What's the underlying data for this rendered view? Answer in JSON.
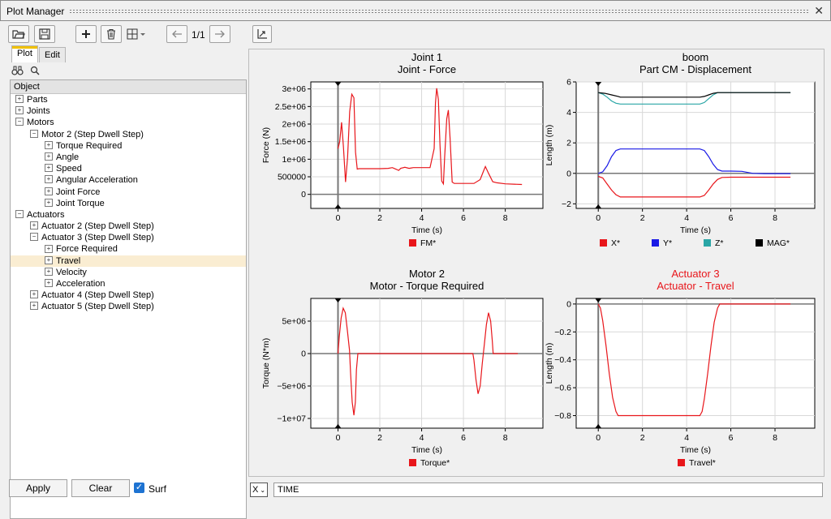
{
  "window": {
    "title": "Plot Manager"
  },
  "toolbar": {
    "page": "1/1"
  },
  "left_panel": {
    "tabs": [
      {
        "label": "Plot"
      },
      {
        "label": "Edit"
      }
    ],
    "tree_header": "Object",
    "tree": [
      {
        "label": "Parts",
        "depth": 0,
        "exp": "+"
      },
      {
        "label": "Joints",
        "depth": 0,
        "exp": "+"
      },
      {
        "label": "Motors",
        "depth": 0,
        "exp": "−"
      },
      {
        "label": "Motor 2 (Step Dwell Step)",
        "depth": 1,
        "exp": "−"
      },
      {
        "label": "Torque Required",
        "depth": 2,
        "exp": "+"
      },
      {
        "label": "Angle",
        "depth": 2,
        "exp": "+"
      },
      {
        "label": "Speed",
        "depth": 2,
        "exp": "+"
      },
      {
        "label": "Angular Acceleration",
        "depth": 2,
        "exp": "+"
      },
      {
        "label": "Joint Force",
        "depth": 2,
        "exp": "+"
      },
      {
        "label": "Joint Torque",
        "depth": 2,
        "exp": "+"
      },
      {
        "label": "Actuators",
        "depth": 0,
        "exp": "−"
      },
      {
        "label": "Actuator 2 (Step Dwell Step)",
        "depth": 1,
        "exp": "+"
      },
      {
        "label": "Actuator 3 (Step Dwell Step)",
        "depth": 1,
        "exp": "−"
      },
      {
        "label": "Force Required",
        "depth": 2,
        "exp": "+"
      },
      {
        "label": "Travel",
        "depth": 2,
        "exp": "+",
        "selected": true
      },
      {
        "label": "Velocity",
        "depth": 2,
        "exp": "+"
      },
      {
        "label": "Acceleration",
        "depth": 2,
        "exp": "+"
      },
      {
        "label": "Actuator 4 (Step Dwell Step)",
        "depth": 1,
        "exp": "+"
      },
      {
        "label": "Actuator 5 (Step Dwell Step)",
        "depth": 1,
        "exp": "+"
      }
    ],
    "apply_label": "Apply",
    "clear_label": "Clear",
    "surf_label": "Surf",
    "surf_checked": true
  },
  "bottom_bar": {
    "axis": "X",
    "expression": "TIME"
  },
  "colors": {
    "red": "#e8161b",
    "blue": "#1a1ae6",
    "teal": "#2aa6a6",
    "black": "#000000",
    "selected_row": "#faedd2"
  },
  "chart_data": [
    {
      "type": "line",
      "title": "Joint 1",
      "subtitle": "Joint - Force",
      "title_color": "#000000",
      "xlabel": "Time (s)",
      "ylabel": "Force (N)",
      "xlim": [
        -1.3,
        9.8
      ],
      "ylim": [
        -400000,
        3200000
      ],
      "xticks": [
        0,
        2,
        4,
        6,
        8
      ],
      "yticks": [
        0,
        500000,
        1000000,
        1500000,
        2000000,
        2500000,
        3000000
      ],
      "ytick_labels": [
        "0",
        "500000",
        "1e+06",
        "1.5e+06",
        "2e+06",
        "2.5e+06",
        "3e+06"
      ],
      "series": [
        {
          "name": "FM*",
          "color": "#e8161b",
          "x": [
            0,
            0.08,
            0.17,
            0.26,
            0.36,
            0.46,
            0.56,
            0.66,
            0.76,
            0.84,
            0.92,
            1.0,
            1.2,
            1.6,
            2.0,
            2.4,
            2.6,
            2.8,
            2.9,
            3.0,
            3.2,
            3.4,
            3.6,
            4.0,
            4.4,
            4.6,
            4.66,
            4.72,
            4.8,
            4.88,
            4.96,
            5.04,
            5.1,
            5.2,
            5.28,
            5.36,
            5.46,
            5.56,
            5.64,
            5.8,
            6.0,
            6.5,
            6.8,
            6.95,
            7.05,
            7.2,
            7.4,
            7.6,
            8.0,
            8.4,
            8.8
          ],
          "y": [
            1300000,
            1500000,
            2050000,
            1350000,
            350000,
            1050000,
            2350000,
            2850000,
            2750000,
            1200000,
            720000,
            730000,
            730000,
            730000,
            730000,
            740000,
            760000,
            710000,
            680000,
            740000,
            770000,
            740000,
            760000,
            760000,
            760000,
            1300000,
            2600000,
            3020000,
            2700000,
            1400000,
            380000,
            300000,
            1050000,
            2150000,
            2400000,
            1600000,
            350000,
            310000,
            310000,
            310000,
            310000,
            310000,
            420000,
            650000,
            790000,
            600000,
            360000,
            330000,
            300000,
            290000,
            280000
          ]
        }
      ]
    },
    {
      "type": "line",
      "title": "boom",
      "subtitle": "Part CM - Displacement",
      "title_color": "#000000",
      "xlabel": "Time (s)",
      "ylabel": "Length (m)",
      "xlim": [
        -1.0,
        9.8
      ],
      "ylim": [
        -2.3,
        6.0
      ],
      "xticks": [
        0,
        2,
        4,
        6,
        8
      ],
      "yticks": [
        -2,
        0,
        2,
        4,
        6
      ],
      "ytick_labels": [
        "−2",
        "0",
        "2",
        "4",
        "6"
      ],
      "series": [
        {
          "name": "X*",
          "color": "#e8161b",
          "x": [
            0,
            0.2,
            0.4,
            0.6,
            0.8,
            1.0,
            2.0,
            3.0,
            4.0,
            4.6,
            4.8,
            5.0,
            5.2,
            5.4,
            5.6,
            6.0,
            7.0,
            8.0,
            8.7
          ],
          "y": [
            -0.2,
            -0.3,
            -0.7,
            -1.1,
            -1.4,
            -1.55,
            -1.55,
            -1.55,
            -1.55,
            -1.55,
            -1.45,
            -1.1,
            -0.7,
            -0.4,
            -0.27,
            -0.25,
            -0.25,
            -0.25,
            -0.25
          ]
        },
        {
          "name": "Y*",
          "color": "#1a1ae6",
          "x": [
            0,
            0.2,
            0.4,
            0.6,
            0.8,
            1.0,
            2.0,
            3.0,
            4.0,
            4.6,
            4.8,
            5.0,
            5.2,
            5.4,
            5.6,
            6.0,
            6.5,
            7.0,
            7.5,
            8.0,
            8.7
          ],
          "y": [
            0.0,
            0.1,
            0.5,
            1.1,
            1.5,
            1.6,
            1.6,
            1.6,
            1.6,
            1.6,
            1.5,
            1.1,
            0.6,
            0.25,
            0.15,
            0.15,
            0.13,
            0.0,
            -0.02,
            -0.02,
            -0.02
          ]
        },
        {
          "name": "Z*",
          "color": "#2aa6a6",
          "x": [
            0,
            0.2,
            0.4,
            0.6,
            0.8,
            1.0,
            2.0,
            3.0,
            4.0,
            4.6,
            4.8,
            5.0,
            5.2,
            5.4,
            5.6,
            6.0,
            7.0,
            8.0,
            8.7
          ],
          "y": [
            5.3,
            5.2,
            5.0,
            4.75,
            4.6,
            4.55,
            4.55,
            4.55,
            4.55,
            4.55,
            4.65,
            4.9,
            5.15,
            5.3,
            5.3,
            5.3,
            5.3,
            5.3,
            5.3
          ]
        },
        {
          "name": "MAG*",
          "color": "#000000",
          "x": [
            0,
            0.3,
            0.6,
            0.9,
            1.0,
            2.0,
            3.0,
            4.0,
            4.6,
            4.8,
            5.0,
            5.2,
            5.4,
            6.0,
            7.0,
            8.0,
            8.7
          ],
          "y": [
            5.3,
            5.25,
            5.15,
            5.05,
            5.0,
            5.0,
            5.0,
            5.0,
            5.0,
            5.05,
            5.15,
            5.25,
            5.3,
            5.3,
            5.3,
            5.3,
            5.3
          ]
        }
      ]
    },
    {
      "type": "line",
      "title": "Motor 2",
      "subtitle": "Motor - Torque Required",
      "title_color": "#000000",
      "xlabel": "Time (s)",
      "ylabel": "Torque (N*m)",
      "xlim": [
        -1.3,
        9.8
      ],
      "ylim": [
        -11500000,
        8500000
      ],
      "xticks": [
        0,
        2,
        4,
        6,
        8
      ],
      "yticks": [
        -10000000,
        -5000000,
        0,
        5000000
      ],
      "ytick_labels": [
        "−1e+07",
        "−5e+06",
        "0",
        "5e+06"
      ],
      "series": [
        {
          "name": "Torque*",
          "color": "#e8161b",
          "x": [
            0,
            0.06,
            0.15,
            0.25,
            0.35,
            0.45,
            0.55,
            0.6,
            0.68,
            0.76,
            0.83,
            0.88,
            0.95,
            1.0,
            2.0,
            3.0,
            4.0,
            5.0,
            6.0,
            6.45,
            6.5,
            6.6,
            6.7,
            6.8,
            6.9,
            7.0,
            7.1,
            7.2,
            7.3,
            7.38,
            7.42,
            7.5,
            8.0,
            8.6
          ],
          "y": [
            0,
            2500000,
            5500000,
            7000000,
            6300000,
            3500000,
            500000,
            -3000000,
            -7500000,
            -9500000,
            -7500000,
            -2500000,
            0,
            0,
            0,
            0,
            0,
            0,
            0,
            0,
            -1000000,
            -4000000,
            -6200000,
            -5000000,
            -1500000,
            1500000,
            4500000,
            6300000,
            5000000,
            2000000,
            0,
            0,
            0,
            0
          ]
        }
      ]
    },
    {
      "type": "line",
      "title": "Actuator 3",
      "subtitle": "Actuator - Travel",
      "title_color": "#e8161b",
      "xlabel": "Time (s)",
      "ylabel": "Length (m)",
      "xlim": [
        -1.0,
        9.8
      ],
      "ylim": [
        -0.89,
        0.04
      ],
      "xticks": [
        0,
        2,
        4,
        6,
        8
      ],
      "yticks": [
        -0.8,
        -0.6,
        -0.4,
        -0.2,
        0
      ],
      "ytick_labels": [
        "−0.8",
        "−0.6",
        "−0.4",
        "−0.2",
        "0"
      ],
      "series": [
        {
          "name": "Travel*",
          "color": "#e8161b",
          "x": [
            0,
            0.1,
            0.2,
            0.35,
            0.5,
            0.65,
            0.8,
            0.9,
            1.0,
            2.0,
            3.0,
            4.0,
            4.6,
            4.7,
            4.8,
            4.95,
            5.1,
            5.25,
            5.4,
            5.5,
            5.6,
            6.0,
            7.0,
            8.0,
            8.7
          ],
          "y": [
            0,
            -0.03,
            -0.12,
            -0.3,
            -0.5,
            -0.67,
            -0.77,
            -0.8,
            -0.8,
            -0.8,
            -0.8,
            -0.8,
            -0.8,
            -0.77,
            -0.68,
            -0.5,
            -0.3,
            -0.13,
            -0.03,
            0,
            0,
            0,
            0,
            0,
            0
          ]
        }
      ]
    }
  ]
}
